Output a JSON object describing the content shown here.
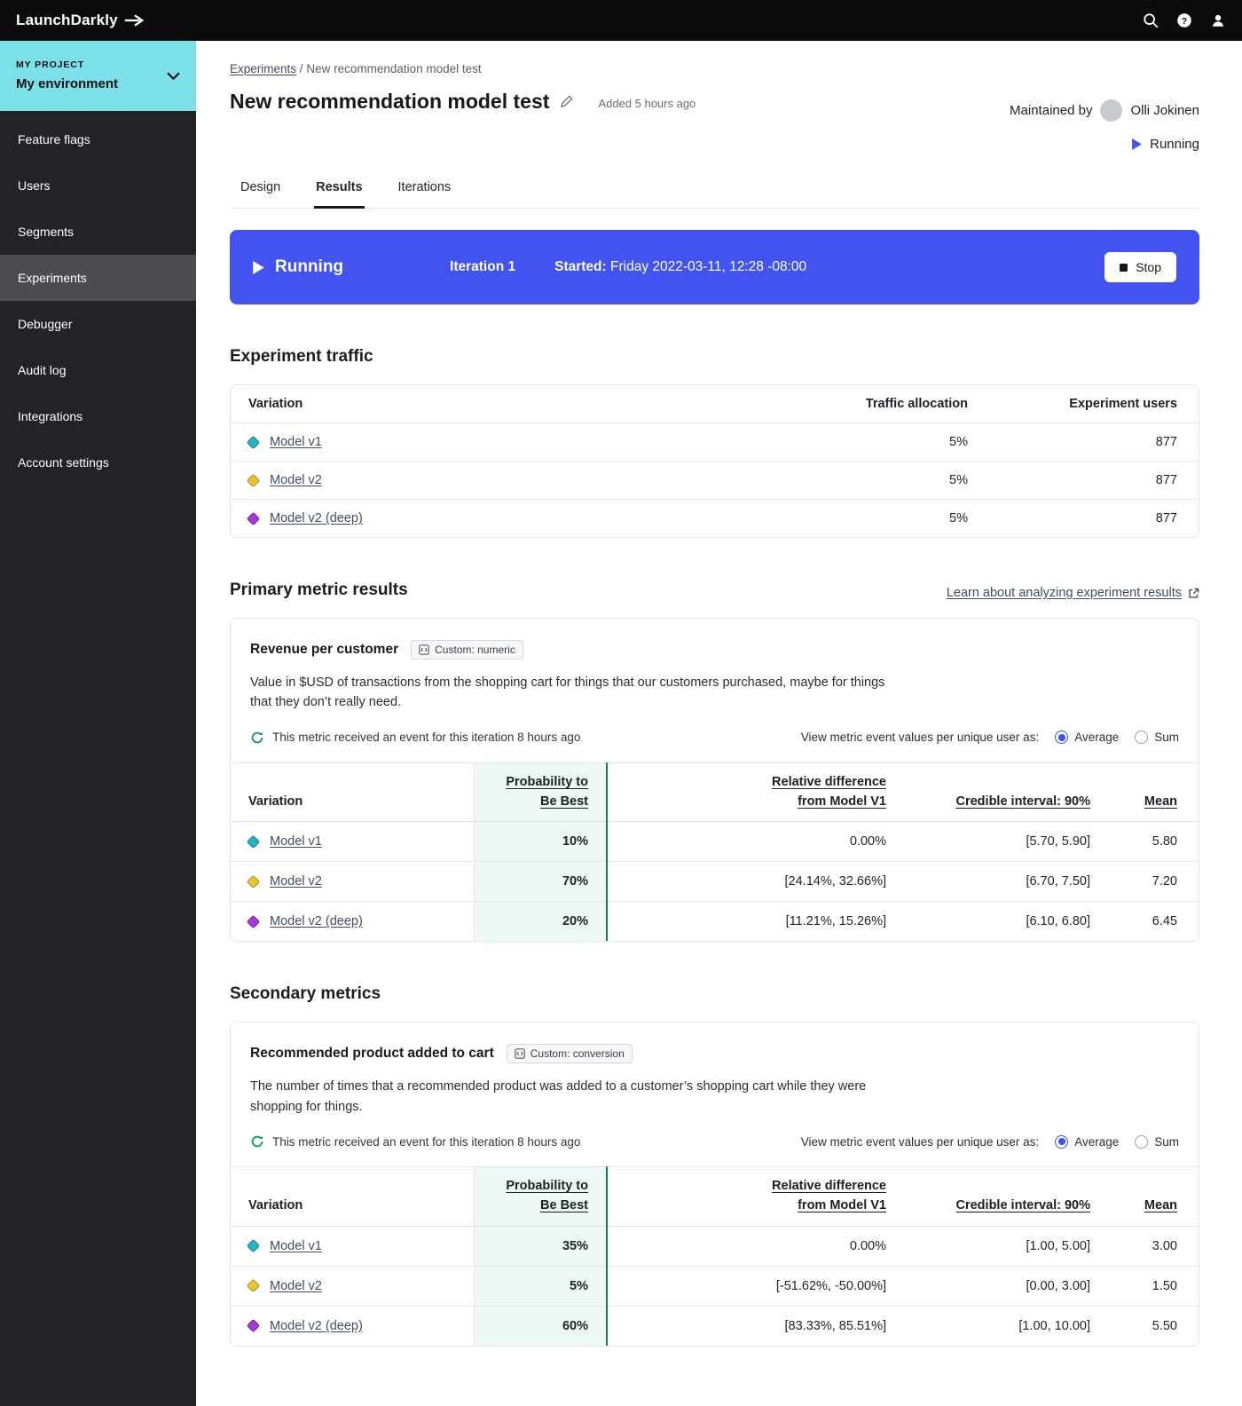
{
  "colors": {
    "accent_blue": "#4353F0",
    "env_teal": "#7CE0E8",
    "prob_column_green": "#EDF8F2",
    "prob_divider_green": "#0F7E6B",
    "link_navy": "#414D66",
    "variation_v1": "#25B3C7",
    "variation_v2": "#E9C62F",
    "variation_v3": "#A636D8"
  },
  "topbar": {
    "logo": "LaunchDarkly"
  },
  "sidebar": {
    "project_label": "MY PROJECT",
    "environment": "My environment",
    "items": [
      {
        "label": "Feature flags"
      },
      {
        "label": "Users"
      },
      {
        "label": "Segments"
      },
      {
        "label": "Experiments"
      },
      {
        "label": "Debugger"
      },
      {
        "label": "Audit log"
      },
      {
        "label": "Integrations"
      },
      {
        "label": "Account settings"
      }
    ]
  },
  "header": {
    "breadcrumb": {
      "link": "Experiments",
      "sep": "/",
      "current": "New recommendation model test"
    },
    "title": "New recommendation model test",
    "added": "Added 5 hours ago",
    "maintained_by": "Maintained by",
    "maintainer": "Olli Jokinen",
    "status": "Running"
  },
  "tabs": [
    {
      "label": "Design"
    },
    {
      "label": "Results"
    },
    {
      "label": "Iterations"
    }
  ],
  "banner": {
    "status": "Running",
    "iteration": "Iteration 1",
    "started_label": "Started:",
    "started_value": "Friday 2022-03-11, 12:28 -08:00",
    "stop": "Stop"
  },
  "traffic": {
    "heading": "Experiment traffic",
    "columns": {
      "variation": "Variation",
      "allocation": "Traffic allocation",
      "users": "Experiment users"
    },
    "rows": [
      {
        "variation": "Model v1",
        "color": "#25B3C7",
        "allocation": "5%",
        "users": "877"
      },
      {
        "variation": "Model v2",
        "color": "#E9C62F",
        "allocation": "5%",
        "users": "877"
      },
      {
        "variation": "Model v2 (deep)",
        "color": "#A636D8",
        "allocation": "5%",
        "users": "877"
      }
    ]
  },
  "primary": {
    "heading": "Primary metric results",
    "learn_link": "Learn about analyzing experiment results",
    "metric": {
      "name": "Revenue per customer",
      "badge": "Custom: numeric",
      "description": "Value in $USD of transactions from the shopping cart for things that our customers purchased, maybe for things that they don’t really need.",
      "event_note": "This metric received an event for this iteration 8 hours ago",
      "view_label": "View metric event values per unique user as:",
      "options": [
        "Average",
        "Sum"
      ],
      "selected": "Average",
      "columns": {
        "variation": "Variation",
        "prob": "Probability to Be Best",
        "rel": "Relative difference from Model V1",
        "ci": "Credible interval: 90%",
        "mean": "Mean"
      },
      "rows": [
        {
          "variation": "Model v1",
          "color": "#25B3C7",
          "prob": "10%",
          "rel": "0.00%",
          "ci": "[5.70, 5.90]",
          "mean": "5.80"
        },
        {
          "variation": "Model v2",
          "color": "#E9C62F",
          "prob": "70%",
          "rel": "[24.14%, 32.66%]",
          "ci": "[6.70, 7.50]",
          "mean": "7.20"
        },
        {
          "variation": "Model v2 (deep)",
          "color": "#A636D8",
          "prob": "20%",
          "rel": "[11.21%, 15.26%]",
          "ci": "[6.10, 6.80]",
          "mean": "6.45"
        }
      ]
    }
  },
  "secondary": {
    "heading": "Secondary metrics",
    "metric": {
      "name": "Recommended product added to cart",
      "badge": "Custom: conversion",
      "description": "The number of times that a recommended product was added to a customer’s shopping cart while they were shopping for things.",
      "event_note": "This metric received an event for this iteration 8 hours ago",
      "view_label": "View metric event values per unique user as:",
      "options": [
        "Average",
        "Sum"
      ],
      "selected": "Average",
      "columns": {
        "variation": "Variation",
        "prob": "Probability to Be Best",
        "rel": "Relative difference from Model V1",
        "ci": "Credible interval: 90%",
        "mean": "Mean"
      },
      "rows": [
        {
          "variation": "Model v1",
          "color": "#25B3C7",
          "prob": "35%",
          "rel": "0.00%",
          "ci": "[1.00, 5.00]",
          "mean": "3.00"
        },
        {
          "variation": "Model v2",
          "color": "#E9C62F",
          "prob": "5%",
          "rel": "[-51.62%, -50.00%]",
          "ci": "[0.00, 3.00]",
          "mean": "1.50"
        },
        {
          "variation": "Model v2 (deep)",
          "color": "#A636D8",
          "prob": "60%",
          "rel": "[83.33%, 85.51%]",
          "ci": "[1.00, 10.00]",
          "mean": "5.50"
        }
      ]
    }
  }
}
